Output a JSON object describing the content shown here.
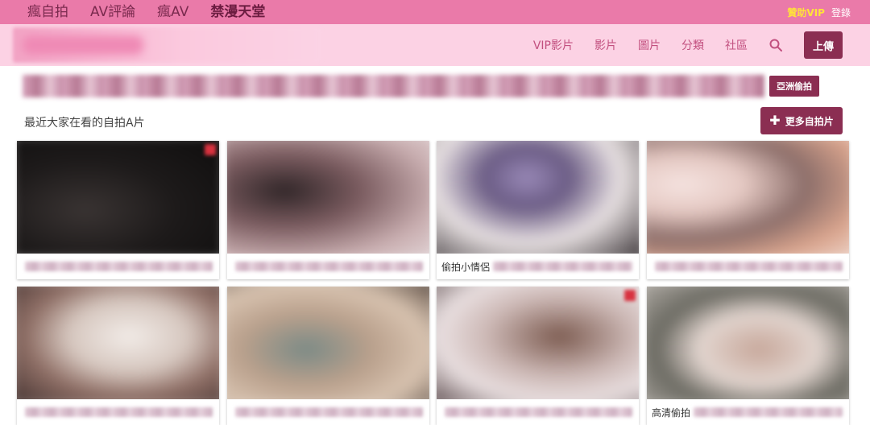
{
  "top_nav": {
    "items": [
      "瘋自拍",
      "AV評論",
      "瘋AV",
      "禁漫天堂"
    ],
    "vip_label": "贊助VIP",
    "login_label": "登錄"
  },
  "main_nav": {
    "items": [
      "VIP影片",
      "影片",
      "圖片",
      "分類",
      "社區"
    ],
    "search_icon": "search-icon",
    "upload_label": "上傳"
  },
  "banner": {
    "tag_label": "亞洲偷拍"
  },
  "section": {
    "title": "最近大家在看的自拍A片",
    "more_label": "更多自拍片",
    "more_icon": "plus-icon"
  },
  "videos": [
    {
      "caption": ""
    },
    {
      "caption": ""
    },
    {
      "caption": "偷拍小情侶"
    },
    {
      "caption": ""
    },
    {
      "caption": ""
    },
    {
      "caption": ""
    },
    {
      "caption": ""
    },
    {
      "caption": "高清偷拍"
    }
  ],
  "colors": {
    "top_bar": "#ea7aa9",
    "header_bg": "#fcd2e4",
    "accent": "#8b2e52",
    "nav_text": "#c2507f",
    "vip": "#ffe23a"
  }
}
